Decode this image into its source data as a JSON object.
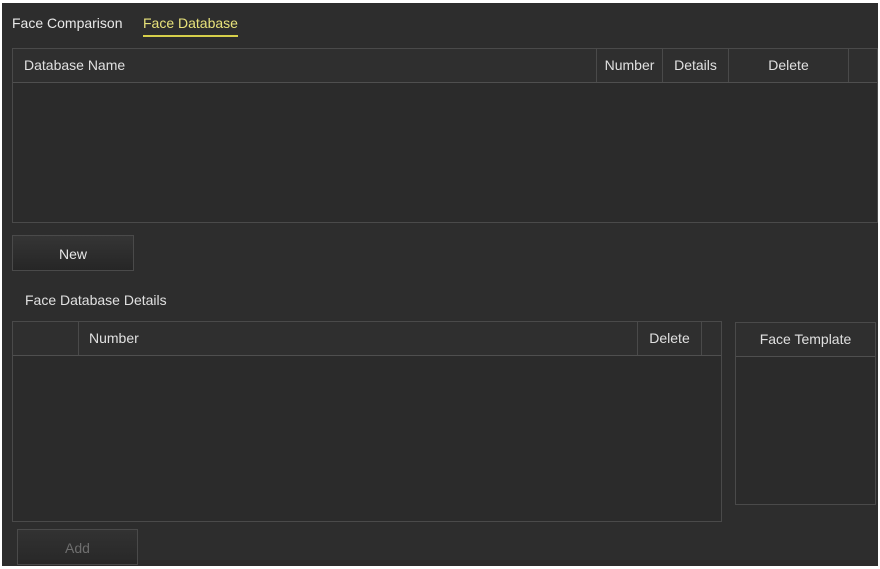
{
  "tabs": [
    {
      "label": "Face Comparison",
      "active": false
    },
    {
      "label": "Face Database",
      "active": true
    }
  ],
  "database_table": {
    "columns": [
      "Database Name",
      "Number",
      "Details",
      "Delete"
    ],
    "rows": []
  },
  "buttons": {
    "new_label": "New",
    "add_label": "Add"
  },
  "details_section": {
    "title": "Face Database Details",
    "columns": [
      "",
      "Number",
      "Delete"
    ],
    "rows": []
  },
  "face_template": {
    "title": "Face Template"
  },
  "colors": {
    "background": "#2d2d2d",
    "active_tab": "#e8e27a",
    "border": "#4a4a4a"
  }
}
